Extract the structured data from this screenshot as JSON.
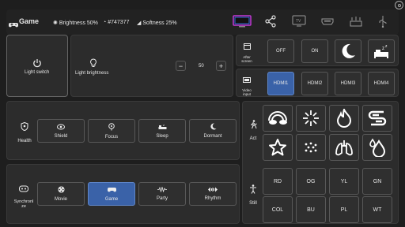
{
  "header": {
    "title": "Game",
    "brightness": "Brightness 50%",
    "color": "#747377",
    "softness": "Softness 25%"
  },
  "light_switch": {
    "label": "Light switch"
  },
  "light_brightness": {
    "label": "Light brightness",
    "value": "50",
    "minus": "−",
    "plus": "+"
  },
  "after_screen": {
    "label_line1": "After",
    "label_line2": "screen",
    "off": "OFF",
    "on": "ON"
  },
  "video_input": {
    "label_line1": "Video",
    "label_line2": "input",
    "items": [
      "HDMI1",
      "HDMI2",
      "HDMI3",
      "HDMI4"
    ],
    "selected": "HDMI1"
  },
  "health": {
    "label": "Health",
    "items": [
      "Shield",
      "Focus",
      "Sleep",
      "Dormant"
    ]
  },
  "synchronize": {
    "label_line1": "Synchronl",
    "label_line2": "ze",
    "items": [
      "Movie",
      "Game",
      "Party",
      "Rhythm"
    ],
    "selected": "Game"
  },
  "act": {
    "label": "Act"
  },
  "still": {
    "label": "Still",
    "colors": [
      "RD",
      "OG",
      "YL",
      "GN",
      "COL",
      "BU",
      "PL",
      "WT"
    ]
  },
  "colors": {
    "accent": "#3a62a8",
    "background": "#1e1e1e",
    "panel": "#2c2c2c"
  }
}
